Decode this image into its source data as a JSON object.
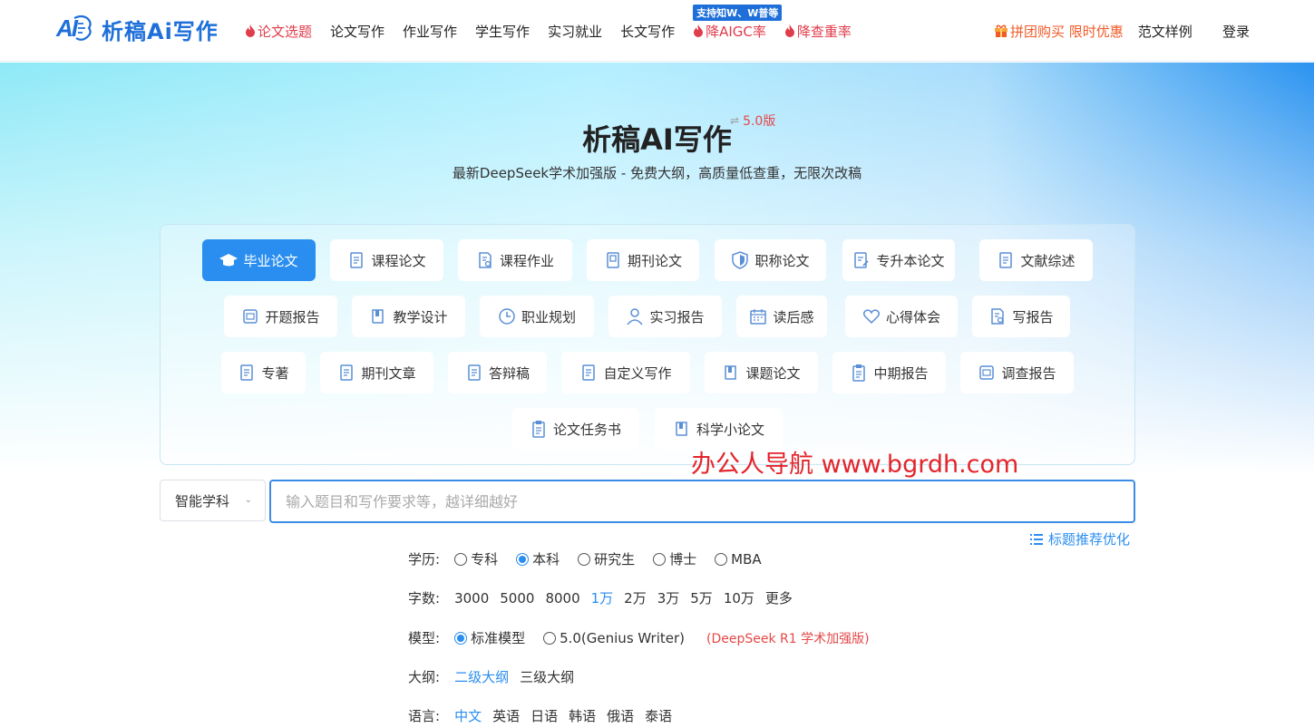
{
  "header": {
    "brand": "析稿Ai写作",
    "nav": [
      {
        "label": "论文选题",
        "hot": true
      },
      {
        "label": "论文写作",
        "hot": false
      },
      {
        "label": "作业写作",
        "hot": false
      },
      {
        "label": "学生写作",
        "hot": false
      },
      {
        "label": "实习就业",
        "hot": false
      },
      {
        "label": "长文写作",
        "hot": false
      },
      {
        "label": "降AIGC率",
        "hot": true,
        "badge": "支持知W、W普等"
      },
      {
        "label": "降查重率",
        "hot": true
      }
    ],
    "promo": "拼团购买 限时优惠",
    "samples": "范文样例",
    "login": "登录"
  },
  "hero": {
    "title": "析稿AI写作",
    "version": "5.0版",
    "subtitle": "最新DeepSeek学术加强版 - 免费大纲，高质量低查重，无限次改稿"
  },
  "categories": [
    {
      "label": "毕业论文",
      "icon": "graduation-cap-icon",
      "active": true
    },
    {
      "label": "课程论文",
      "icon": "document-icon"
    },
    {
      "label": "课程作业",
      "icon": "document-search-icon"
    },
    {
      "label": "期刊论文",
      "icon": "journal-icon"
    },
    {
      "label": "职称论文",
      "icon": "shield-icon"
    },
    {
      "label": "专升本论文",
      "icon": "document-edit-icon"
    },
    {
      "label": "文献综述",
      "icon": "document-icon"
    },
    {
      "label": "开题报告",
      "icon": "report-icon"
    },
    {
      "label": "教学设计",
      "icon": "book-icon"
    },
    {
      "label": "职业规划",
      "icon": "clock-icon"
    },
    {
      "label": "实习报告",
      "icon": "user-icon"
    },
    {
      "label": "读后感",
      "icon": "calendar-icon"
    },
    {
      "label": "心得体会",
      "icon": "heart-icon"
    },
    {
      "label": "写报告",
      "icon": "document-search-icon"
    },
    {
      "label": "专著",
      "icon": "document-icon"
    },
    {
      "label": "期刊文章",
      "icon": "document-icon"
    },
    {
      "label": "答辩稿",
      "icon": "document-icon"
    },
    {
      "label": "自定义写作",
      "icon": "document-icon"
    },
    {
      "label": "课题论文",
      "icon": "book-icon"
    },
    {
      "label": "中期报告",
      "icon": "clipboard-icon"
    },
    {
      "label": "调查报告",
      "icon": "report-icon"
    },
    {
      "label": "论文任务书",
      "icon": "clipboard-icon"
    },
    {
      "label": "科学小论文",
      "icon": "book-icon"
    }
  ],
  "watermark": "办公人导航 www.bgrdh.com",
  "input": {
    "subject": "智能学科",
    "placeholder": "输入题目和写作要求等，越详细越好",
    "optimize": "标题推荐优化"
  },
  "options": {
    "education": {
      "label": "学历:",
      "items": [
        "专科",
        "本科",
        "研究生",
        "博士",
        "MBA"
      ],
      "selected": "本科"
    },
    "words": {
      "label": "字数:",
      "items": [
        "3000",
        "5000",
        "8000",
        "1万",
        "2万",
        "3万",
        "5万",
        "10万",
        "更多"
      ],
      "selected": "1万"
    },
    "model": {
      "label": "模型:",
      "items": [
        "标准模型",
        "5.0(Genius Writer)"
      ],
      "selected": "标准模型",
      "note": "(DeepSeek R1 学术加强版)"
    },
    "outline": {
      "label": "大纲:",
      "items": [
        "二级大纲",
        "三级大纲"
      ],
      "selected": "二级大纲"
    },
    "language": {
      "label": "语言:",
      "items": [
        "中文",
        "英语",
        "日语",
        "韩语",
        "俄语",
        "泰语"
      ],
      "selected": "中文"
    }
  },
  "colors": {
    "accent": "#2a8ef0",
    "hot": "#e03c4b",
    "promo": "#f05a28",
    "watermark": "#e3242b"
  }
}
